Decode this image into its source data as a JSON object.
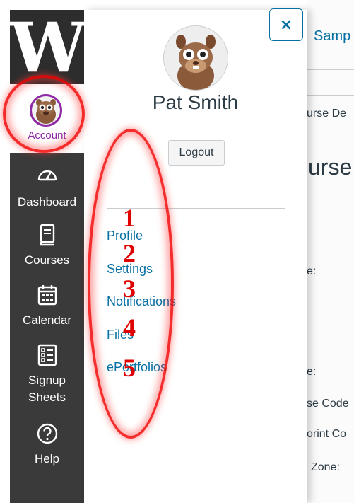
{
  "global_nav": {
    "logo_text": "W",
    "items": [
      {
        "label": "Account",
        "icon": "user-avatar-icon"
      },
      {
        "label": "Dashboard",
        "icon": "speedometer-icon"
      },
      {
        "label": "Courses",
        "icon": "book-icon"
      },
      {
        "label": "Calendar",
        "icon": "calendar-icon"
      },
      {
        "label": "Signup\nSheets",
        "icon": "list-checkbox-icon"
      },
      {
        "label": "Help",
        "icon": "question-circle-icon"
      }
    ]
  },
  "tray": {
    "user_name": "Pat Smith",
    "logout_label": "Logout",
    "close_label": "×",
    "links": [
      "Profile",
      "Settings",
      "Notifications",
      "Files",
      "ePortfolios"
    ]
  },
  "background_page": {
    "header_link": "Samp",
    "breadcrumb": "urse De",
    "heading": "urse",
    "labels": [
      "e:",
      "e:",
      "se Code",
      "orint Co",
      "Zone:"
    ]
  },
  "annotations": {
    "numbers": [
      "1",
      "2",
      "3",
      "4",
      "5"
    ]
  },
  "colors": {
    "nav_bg": "#3a3a3a",
    "account_purple": "#8e2aa4",
    "link_blue": "#0770a3",
    "annotation_red": "#e00000"
  }
}
